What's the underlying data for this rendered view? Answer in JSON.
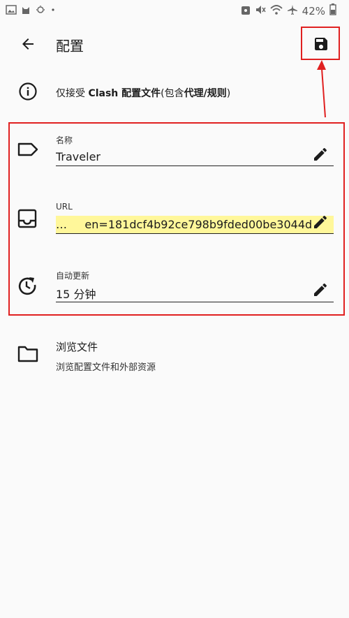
{
  "status_bar": {
    "battery_text": "42%",
    "icons": [
      "gallery-icon",
      "cat-icon",
      "sun-icon",
      "dot-icon",
      "vpn-key-icon",
      "mute-icon",
      "wifi-icon",
      "airplane-icon",
      "battery-icon"
    ]
  },
  "app_bar": {
    "title": "配置",
    "back_icon": "arrow-left-icon",
    "save_icon": "floppy-disk-icon"
  },
  "info": {
    "icon": "info-icon",
    "text_prefix": "仅接受 ",
    "text_bold": "Clash 配置文件",
    "text_mid": "(包含",
    "text_bold2": "代理/规则",
    "text_suffix": ")"
  },
  "fields": [
    {
      "label": "名称",
      "value": "Traveler",
      "icon": "tag-icon"
    },
    {
      "label": "URL",
      "value": "…     en=181dcf4b92ce798b9fded00be3044d",
      "icon": "inbox-icon"
    },
    {
      "label": "自动更新",
      "value": "15 分钟",
      "icon": "clock-refresh-icon"
    }
  ],
  "browse": {
    "title": "浏览文件",
    "subtitle": "浏览配置文件和外部资源",
    "icon": "folder-icon"
  },
  "annotation_colors": {
    "highlight": "#e02020",
    "url_highlight": "#fff79a"
  }
}
